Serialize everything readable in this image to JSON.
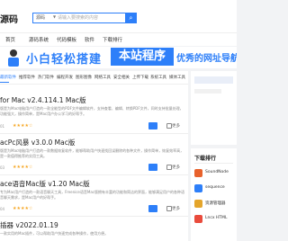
{
  "header": {
    "logo_text": "源码",
    "search": {
      "category": "源码",
      "placeholder": "请输入要搜索的内容"
    }
  },
  "nav": [
    "首页",
    "源码系统",
    "代码模板",
    "软件",
    "下载排行"
  ],
  "banner": {
    "part1": "小白轻松搭建",
    "part2": "本站程序",
    "part3": "优秀的网址导航源码"
  },
  "tabs": [
    "最新软件",
    "推荐软件",
    "热门软件",
    "编程开发",
    "图形图像",
    "网络工具",
    "安全相关",
    "上传下载",
    "系统工具",
    "媒体工具"
  ],
  "articles": [
    {
      "title": "for Mac v2.4.114.1 Mac版",
      "desc": "版是为Mac电脑用户打造的一款全能型的PDF文件编辑软件，支持查看、编辑、转换PDF文件，同时支持批量处理，功能强大，操作简单，是Mac用户办公学习的好帮手。",
      "date": "01",
      "more": "更多"
    },
    {
      "title": "acPc风暴 v3.0.0 Mac版",
      "desc": "版是为Mac电脑用户打造的一款数据恢复软件，能够帮助用户快速找回误删除的各种文件，操作简单，恢复效率高，是一款值得推荐的实用工具。",
      "date": "03",
      "more": "更多"
    },
    {
      "title": "ace语音Mac版 v1.20 Mac版",
      "desc": "专为Mac用户打造的一款语音聊天工具，Freenice语音Mac版拥有丰富的功能和简洁的界面，能够满足用户的各种语音聊天需求，是Mac用户的好帮手。",
      "date": "04",
      "more": "更多"
    },
    {
      "title": "插器 v2022.01.19",
      "desc": "一款实用的Mac插件，可以帮助用户快速完成各种操作，使用方便。",
      "date": "",
      "more": ""
    }
  ],
  "sidebar": {
    "download_rank_title": "下载排行",
    "items": [
      {
        "name": "SoundNode",
        "color": "#e8622c"
      },
      {
        "name": "sequence",
        "color": "#2d7ff9"
      },
      {
        "name": "资源管理器",
        "color": "#e4a52b"
      },
      {
        "name": "Lncx HTML",
        "color": "#e94b3c"
      }
    ]
  }
}
